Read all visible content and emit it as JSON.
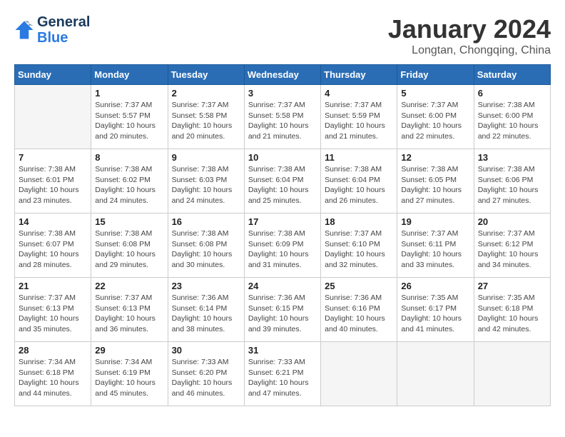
{
  "logo": {
    "line1": "General",
    "line2": "Blue"
  },
  "title": "January 2024",
  "subtitle": "Longtan, Chongqing, China",
  "days_header": [
    "Sunday",
    "Monday",
    "Tuesday",
    "Wednesday",
    "Thursday",
    "Friday",
    "Saturday"
  ],
  "weeks": [
    [
      {
        "num": "",
        "empty": true
      },
      {
        "num": "1",
        "rise": "7:37 AM",
        "set": "5:57 PM",
        "daylight": "10 hours and 20 minutes."
      },
      {
        "num": "2",
        "rise": "7:37 AM",
        "set": "5:58 PM",
        "daylight": "10 hours and 20 minutes."
      },
      {
        "num": "3",
        "rise": "7:37 AM",
        "set": "5:58 PM",
        "daylight": "10 hours and 21 minutes."
      },
      {
        "num": "4",
        "rise": "7:37 AM",
        "set": "5:59 PM",
        "daylight": "10 hours and 21 minutes."
      },
      {
        "num": "5",
        "rise": "7:37 AM",
        "set": "6:00 PM",
        "daylight": "10 hours and 22 minutes."
      },
      {
        "num": "6",
        "rise": "7:38 AM",
        "set": "6:00 PM",
        "daylight": "10 hours and 22 minutes."
      }
    ],
    [
      {
        "num": "7",
        "rise": "7:38 AM",
        "set": "6:01 PM",
        "daylight": "10 hours and 23 minutes."
      },
      {
        "num": "8",
        "rise": "7:38 AM",
        "set": "6:02 PM",
        "daylight": "10 hours and 24 minutes."
      },
      {
        "num": "9",
        "rise": "7:38 AM",
        "set": "6:03 PM",
        "daylight": "10 hours and 24 minutes."
      },
      {
        "num": "10",
        "rise": "7:38 AM",
        "set": "6:04 PM",
        "daylight": "10 hours and 25 minutes."
      },
      {
        "num": "11",
        "rise": "7:38 AM",
        "set": "6:04 PM",
        "daylight": "10 hours and 26 minutes."
      },
      {
        "num": "12",
        "rise": "7:38 AM",
        "set": "6:05 PM",
        "daylight": "10 hours and 27 minutes."
      },
      {
        "num": "13",
        "rise": "7:38 AM",
        "set": "6:06 PM",
        "daylight": "10 hours and 27 minutes."
      }
    ],
    [
      {
        "num": "14",
        "rise": "7:38 AM",
        "set": "6:07 PM",
        "daylight": "10 hours and 28 minutes."
      },
      {
        "num": "15",
        "rise": "7:38 AM",
        "set": "6:08 PM",
        "daylight": "10 hours and 29 minutes."
      },
      {
        "num": "16",
        "rise": "7:38 AM",
        "set": "6:08 PM",
        "daylight": "10 hours and 30 minutes."
      },
      {
        "num": "17",
        "rise": "7:38 AM",
        "set": "6:09 PM",
        "daylight": "10 hours and 31 minutes."
      },
      {
        "num": "18",
        "rise": "7:37 AM",
        "set": "6:10 PM",
        "daylight": "10 hours and 32 minutes."
      },
      {
        "num": "19",
        "rise": "7:37 AM",
        "set": "6:11 PM",
        "daylight": "10 hours and 33 minutes."
      },
      {
        "num": "20",
        "rise": "7:37 AM",
        "set": "6:12 PM",
        "daylight": "10 hours and 34 minutes."
      }
    ],
    [
      {
        "num": "21",
        "rise": "7:37 AM",
        "set": "6:13 PM",
        "daylight": "10 hours and 35 minutes."
      },
      {
        "num": "22",
        "rise": "7:37 AM",
        "set": "6:13 PM",
        "daylight": "10 hours and 36 minutes."
      },
      {
        "num": "23",
        "rise": "7:36 AM",
        "set": "6:14 PM",
        "daylight": "10 hours and 38 minutes."
      },
      {
        "num": "24",
        "rise": "7:36 AM",
        "set": "6:15 PM",
        "daylight": "10 hours and 39 minutes."
      },
      {
        "num": "25",
        "rise": "7:36 AM",
        "set": "6:16 PM",
        "daylight": "10 hours and 40 minutes."
      },
      {
        "num": "26",
        "rise": "7:35 AM",
        "set": "6:17 PM",
        "daylight": "10 hours and 41 minutes."
      },
      {
        "num": "27",
        "rise": "7:35 AM",
        "set": "6:18 PM",
        "daylight": "10 hours and 42 minutes."
      }
    ],
    [
      {
        "num": "28",
        "rise": "7:34 AM",
        "set": "6:18 PM",
        "daylight": "10 hours and 44 minutes."
      },
      {
        "num": "29",
        "rise": "7:34 AM",
        "set": "6:19 PM",
        "daylight": "10 hours and 45 minutes."
      },
      {
        "num": "30",
        "rise": "7:33 AM",
        "set": "6:20 PM",
        "daylight": "10 hours and 46 minutes."
      },
      {
        "num": "31",
        "rise": "7:33 AM",
        "set": "6:21 PM",
        "daylight": "10 hours and 47 minutes."
      },
      {
        "num": "",
        "empty": true
      },
      {
        "num": "",
        "empty": true
      },
      {
        "num": "",
        "empty": true
      }
    ]
  ]
}
